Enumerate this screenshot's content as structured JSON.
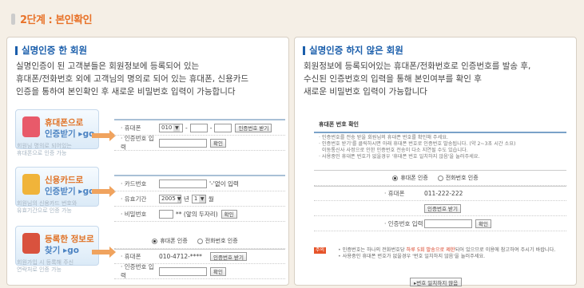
{
  "step_title": "2단계 : 본인확인",
  "left": {
    "title": "실명인증 한 회원",
    "desc": "실명인증이 된 고객분들은 회원정보에 등록되어 있는\n휴대폰/전화번호 외에 고객님의 명의로 되어 있는 휴대폰, 신용카드\n인증을 통하여 본인확인 후 새로운 비밀번호 입력이 가능합니다",
    "phone": {
      "badge_l1": "휴대폰으로",
      "badge_l2": "인증받기 ▸go",
      "badge_note": "회원님 명의로 되어있는\n휴대폰으로 인증 가능",
      "label_phone": "· 휴대폰",
      "carrier": "010",
      "dash1": "-",
      "dash2": "-",
      "btn_request": "인증번호 받기",
      "label_code": "· 인증번호 입력",
      "btn_confirm": "확인"
    },
    "card": {
      "badge_l1": "신용카드로",
      "badge_l2": "인증받기 ▸go",
      "badge_note": "회원님의 신용카드 번호와\n유효기간으로 인증 가능",
      "label_card": "· 카드번호",
      "card_hint": "'-'없이 입력",
      "label_expiry": "· 유효기간",
      "year": "2005",
      "year_unit": "년",
      "month": "1",
      "month_unit": "월",
      "label_pw": "· 비밀번호",
      "pw_hint": "** (앞의 두자리)",
      "btn_confirm": "확인"
    },
    "registered": {
      "badge_l1": "등록한 정보로",
      "badge_l2": "찾기 ▸go",
      "badge_note": "회원가입 시 등록해 주신\n연락처로 인증 가능",
      "radio_phone": "휴대폰 인증",
      "radio_tel": "전화번호 인증",
      "label_phone": "· 휴대폰",
      "phone_value": "010-4712-****",
      "btn_request": "인증번호 받기",
      "label_code": "· 인증번호 입력",
      "btn_confirm": "확인"
    }
  },
  "right": {
    "title": "실명인증 하지 않은 회원",
    "desc": "회원정보에 등록되어있는 휴대폰/전화번호로 인증번호를 발송 후,\n수신된 인증번호의 입력을 통해 본인여부를 확인 후\n새로운 비밀번호 입력이 가능합니다",
    "box_title": "휴대폰 번호 확인",
    "notes": "· 인증번호를 전송 받을 회원님의 휴대폰 번호를 확인해 주세요.\n· 인증번호 받기'를 클릭하시면 아래 휴대폰 번호로 인증번호 발송됩니다. (약 2~3초 시간 소요)\n  이동통신사 사정으로 인한 인증번호 전송이 다소 지연될 수도 있습니다.\n· 사용중인 휴대폰 번호가 없을경우 '휴대폰 번호 일치하지 않음'을 눌러주세요.",
    "radio_phone": "휴대폰 인증",
    "radio_tel": "전화번호 인증",
    "label_phone": "· 휴대폰",
    "phone_value": "011-222-222",
    "btn_request": "인증번호 받기",
    "label_code": "· 인증번호 입력",
    "btn_confirm": "확인",
    "warn_tag": "주의",
    "warn1_a": "인증번호는 하나의 전화번호당 ",
    "warn1_b": "하루 5회 발송으로 제한",
    "warn1_c": "되어 있으므로 이용에 참고하여 주시기 바랍니다.",
    "warn2": "사용중인 휴대폰 번호가 없을경우 '번호 일치하지 않음'을 눌러주세요.",
    "btn_mismatch": "▸번호 일치하지 않음"
  }
}
